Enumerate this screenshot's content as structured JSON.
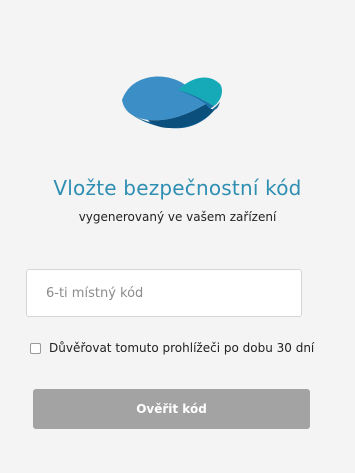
{
  "logo": {
    "icon": "wave-logo-icon",
    "colors": [
      "#3b8fc6",
      "#16a9b8",
      "#0d5d8f",
      "#1a74a8"
    ]
  },
  "header": {
    "title": "Vložte bezpečnostní kód",
    "subtitle": "vygenerovaný ve vašem zařízení"
  },
  "form": {
    "code_placeholder": "6-ti místný kód",
    "code_value": "",
    "trust_label": "Důvěřovat tomuto prohlížeči po dobu 30 dní",
    "trust_checked": false,
    "verify_label": "Ověřit kód"
  },
  "colors": {
    "title": "#2f8fb3",
    "button_disabled": "#a3a3a3",
    "background": "#f4f4f4"
  }
}
